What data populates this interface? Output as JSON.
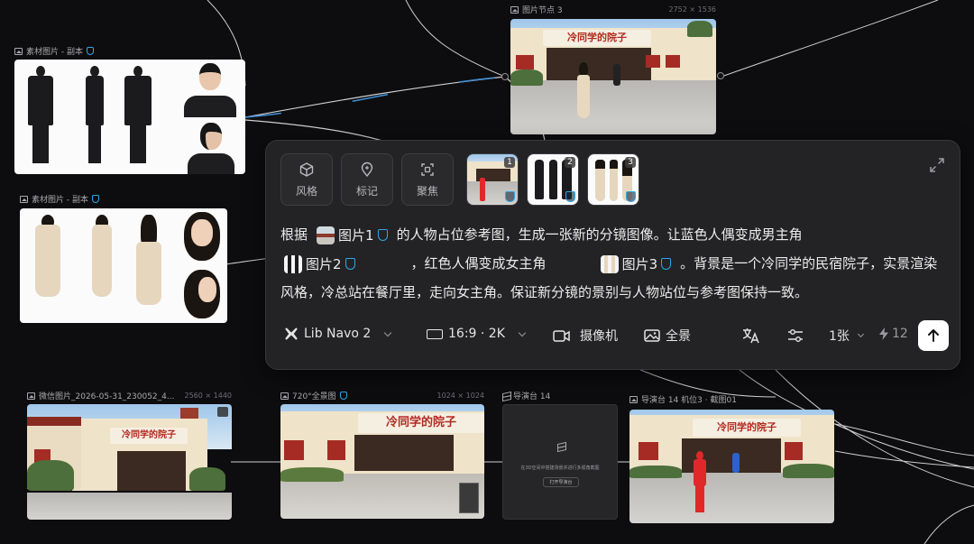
{
  "nodes": {
    "ref_male": {
      "title": "素材图片 - 副本"
    },
    "ref_female": {
      "title": "素材图片 - 副本"
    },
    "image_node_3": {
      "title": "图片节点 3",
      "dimensions": "2752 × 1536"
    },
    "wechat_image": {
      "title": "微信图片_2026-05-31_230052_4...",
      "dimensions": "2560 × 1440"
    },
    "panorama": {
      "title": "720°全景图",
      "dimensions": "1024 × 1024"
    },
    "director_14": {
      "title": "导演台 14",
      "hint": "在3D空间中搭建场景并进行多视角截图",
      "open_button": "打开导演台"
    },
    "director_shot": {
      "title": "导演台 14 机位3 · 截图01"
    }
  },
  "sign_text": "冷同学的院子",
  "panel": {
    "tools": [
      {
        "label": "风格",
        "icon": "cube-icon"
      },
      {
        "label": "标记",
        "icon": "pin-icon"
      },
      {
        "label": "聚焦",
        "icon": "focus-icon"
      }
    ],
    "refs": [
      {
        "num": "1"
      },
      {
        "num": "2"
      },
      {
        "num": "3"
      }
    ],
    "prompt": {
      "p1": "根据",
      "chip1": "图片1",
      "p2": "的人物占位参考图，生成一张新的分镜图像。让蓝色人偶变成男主角",
      "chip2": "图片2",
      "p3": "，红色人偶变成女主角",
      "chip3": "图片3",
      "p4": "。背景是一个冷同学的民宿院子，实景渲染风格，冷总站在餐厅里，走向女主角。保证新分镜的景别与人物站位与参考图保持一致。"
    },
    "model": "Lib Navo 2",
    "ratio": "16:9 · 2K",
    "camera": "摄像机",
    "panorama": "全景",
    "count": "1张",
    "credits": "12"
  },
  "colors": {
    "accent": "#2fa6e8",
    "wire": "#d6d6d6",
    "wire_active": "#3d8fd6"
  }
}
